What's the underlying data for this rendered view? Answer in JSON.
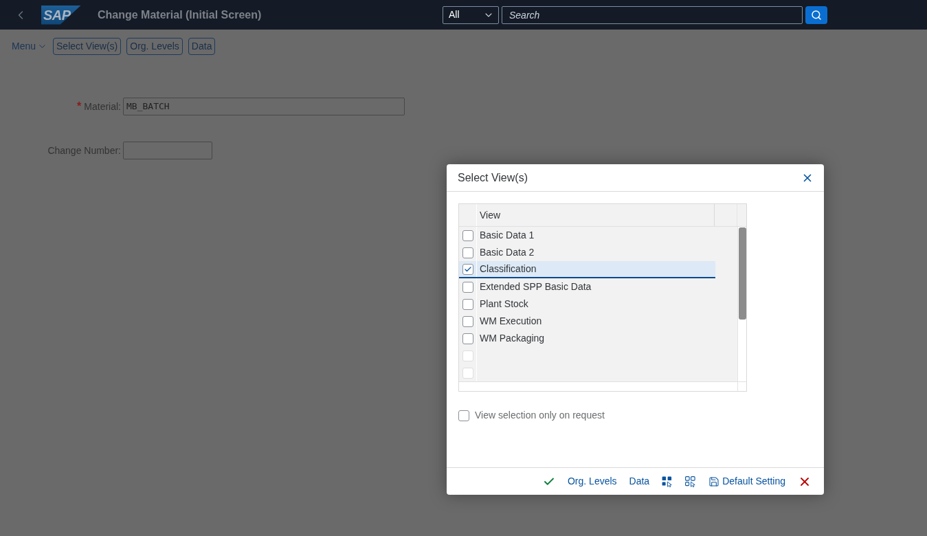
{
  "header": {
    "logo": "SAP",
    "title": "Change Material (Initial Screen)",
    "scope": "All",
    "search": {
      "placeholder": "Search"
    }
  },
  "toolbar": {
    "menu": "Menu",
    "buttons": [
      "Select View(s)",
      "Org. Levels",
      "Data"
    ]
  },
  "form": {
    "fields": [
      {
        "label": "Material:",
        "required_mark": "*",
        "value": "MB_BATCH"
      },
      {
        "label": "Change Number:"
      }
    ]
  },
  "dialog": {
    "title": "Select View(s)",
    "table": {
      "columns": [
        "View"
      ],
      "rows": [
        {
          "view": "Basic Data 1",
          "checked": false,
          "selected": false,
          "disabled": false
        },
        {
          "view": "Basic Data 2",
          "checked": false,
          "selected": false,
          "disabled": false
        },
        {
          "view": "Classification",
          "checked": true,
          "selected": true,
          "disabled": false
        },
        {
          "view": "Extended SPP Basic Data",
          "checked": false,
          "selected": false,
          "disabled": false
        },
        {
          "view": "Plant Stock",
          "checked": false,
          "selected": false,
          "disabled": false
        },
        {
          "view": "WM Execution",
          "checked": false,
          "selected": false,
          "disabled": false
        },
        {
          "view": "WM Packaging",
          "checked": false,
          "selected": false,
          "disabled": false
        },
        {
          "checked": false,
          "selected": false,
          "disabled": true
        },
        {
          "checked": false,
          "selected": false,
          "disabled": true
        }
      ]
    },
    "option": {
      "label": "View selection only on request",
      "checked": false
    },
    "footer": [
      {
        "kind": "confirm"
      },
      {
        "kind": "text",
        "label": "Org. Levels"
      },
      {
        "kind": "text",
        "label": "Data"
      },
      {
        "kind": "select_all"
      },
      {
        "kind": "deselect_all"
      },
      {
        "kind": "save",
        "label": "Default Setting"
      },
      {
        "kind": "cancel"
      }
    ]
  }
}
